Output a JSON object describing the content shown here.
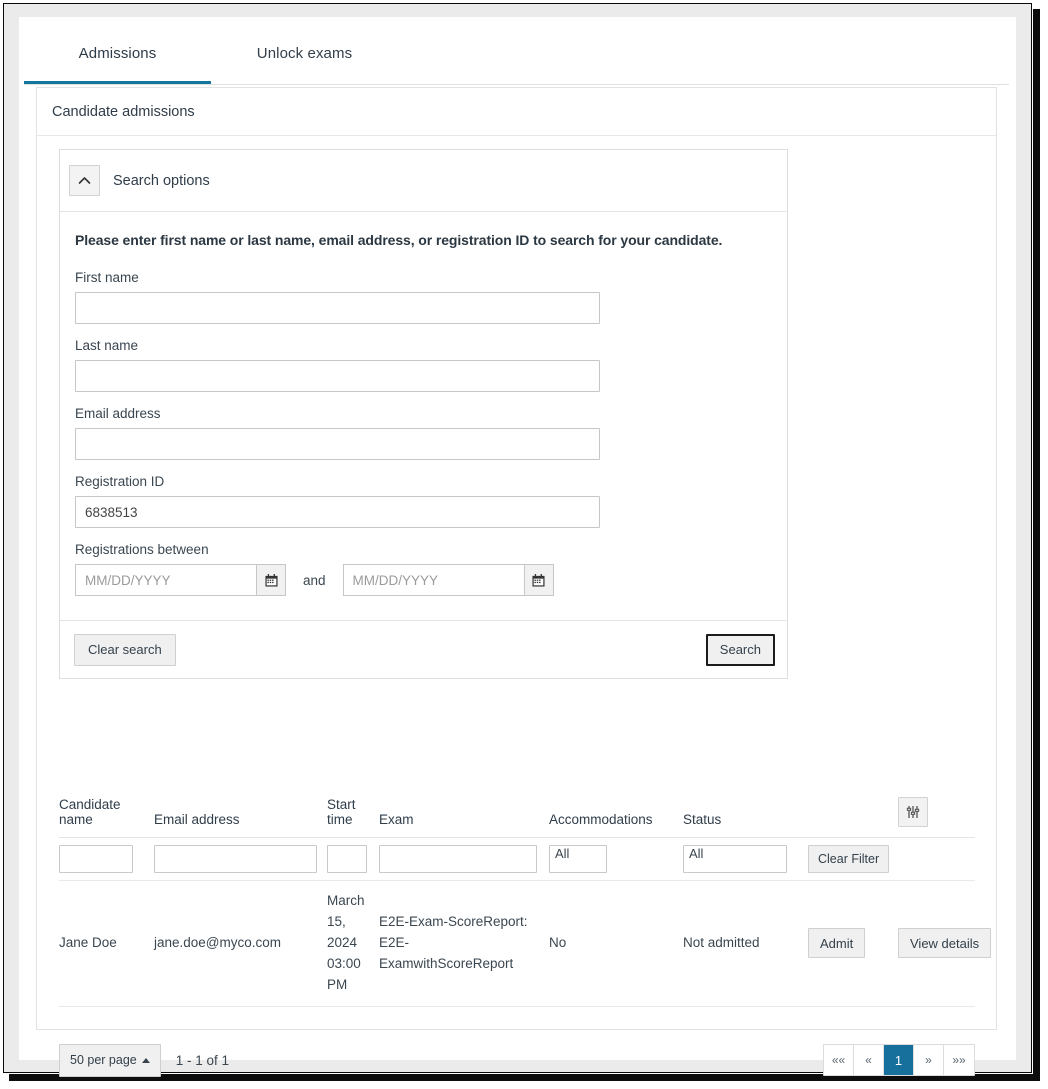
{
  "tabs": [
    {
      "label": "Admissions",
      "active": true
    },
    {
      "label": "Unlock exams",
      "active": false
    }
  ],
  "card": {
    "title": "Candidate admissions"
  },
  "search_panel": {
    "header_label": "Search options",
    "collapse_icon": "chevron-up-icon",
    "intro": "Please enter first name or last name, email address, or registration ID to search for your candidate.",
    "fields": [
      {
        "label": "First name",
        "value": "",
        "placeholder": ""
      },
      {
        "label": "Last name",
        "value": "",
        "placeholder": ""
      },
      {
        "label": "Email address",
        "value": "",
        "placeholder": ""
      },
      {
        "label": "Registration ID",
        "value": "6838513",
        "placeholder": ""
      }
    ],
    "date_range": {
      "label": "Registrations between",
      "from_placeholder": "MM/DD/YYYY",
      "from_value": "",
      "to_placeholder": "MM/DD/YYYY",
      "to_value": "",
      "conjunction": "and",
      "calendar_icon": "calendar-icon"
    },
    "clear_label": "Clear search",
    "search_label": "Search"
  },
  "table": {
    "columns": [
      "Candidate name",
      "Email address",
      "Start time",
      "Exam",
      "Accommodations",
      "Status"
    ],
    "settings_icon": "sliders-icon",
    "filters": {
      "name": "",
      "email": "",
      "start_time": "",
      "exam": "",
      "accommodations": "All",
      "status": "All",
      "clear_label": "Clear Filter"
    },
    "rows": [
      {
        "name": "Jane Doe",
        "email": "jane.doe@myco.com",
        "start_time": "March 15, 2024 03:00 PM",
        "exam": "E2E-Exam-ScoreReport: E2E-ExamwithScoreReport",
        "accommodations": "No",
        "status": "Not admitted",
        "admit_label": "Admit",
        "details_label": "View details"
      }
    ]
  },
  "footer": {
    "per_page_label": "50 per page",
    "range_label": "1 - 1 of 1",
    "pager": {
      "first": "««",
      "prev": "«",
      "current": "1",
      "next": "»",
      "last": "»»"
    }
  },
  "colors": {
    "accent": "#17709B",
    "tab_underline": "#13769F",
    "text": "#3A4650"
  }
}
